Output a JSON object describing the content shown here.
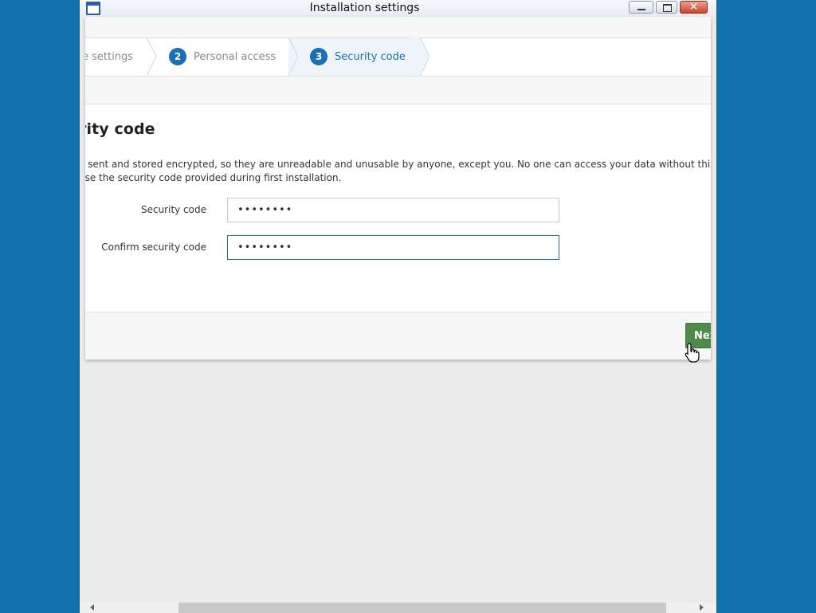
{
  "window": {
    "title": "Installation settings"
  },
  "wizard": {
    "steps": [
      {
        "number": "",
        "label": "e settings"
      },
      {
        "number": "2",
        "label": "Personal access"
      },
      {
        "number": "3",
        "label": "Security code"
      }
    ]
  },
  "form": {
    "heading": "rity code",
    "description_line1": "e sent and stored encrypted, so they are unreadable and unusable by anyone, except you. No one can access your data without this security c",
    "description_line2": "use the security code provided during first installation.",
    "security_code_label": "Security code",
    "security_code_value": "••••••••",
    "confirm_label": "Confirm security code",
    "confirm_value": "••••••••"
  },
  "footer": {
    "next_label": "Nex"
  },
  "colors": {
    "desktop": "#1272ad",
    "accent": "#1c6eb5",
    "next_button": "#4f8a4a"
  }
}
